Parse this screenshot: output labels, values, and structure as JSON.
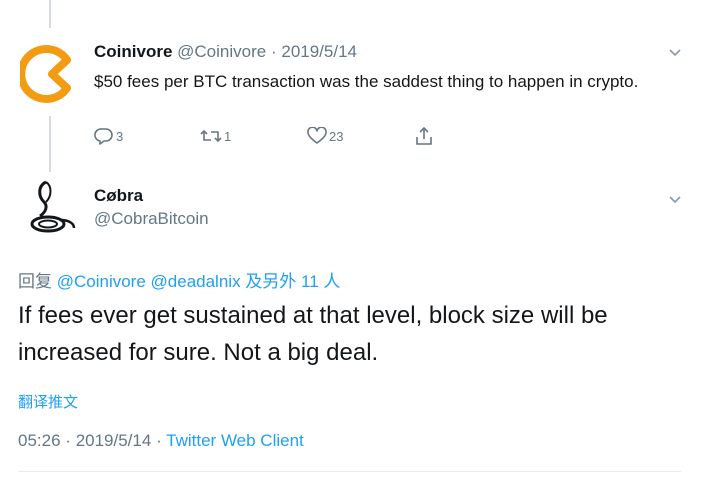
{
  "tweet1": {
    "display_name": "Coinivore",
    "handle": "@Coinivore",
    "separator": "·",
    "date": "2019/5/14",
    "text": "$50 fees per BTC transaction was the saddest thing to happen in crypto.",
    "actions": {
      "reply_count": "3",
      "retweet_count": "1",
      "like_count": "23"
    },
    "avatar_icon": "pacman-logo-icon",
    "accent_color": "#f39c12"
  },
  "tweet2": {
    "display_name": "Cøbra",
    "handle": "@CobraBitcoin",
    "reply_prefix": "回复",
    "reply_mentions": "@Coinivore @deadalnix",
    "reply_suffix": "及另外 11 人",
    "text": "If fees ever get sustained at that level, block size will be increased for sure. Not a big deal.",
    "translate_label": "翻译推文",
    "time": "05:26",
    "separator": "·",
    "date": "2019/5/14",
    "client": "Twitter Web Client",
    "avatar_icon": "cobra-logo-icon"
  },
  "colors": {
    "link": "#1da1f2",
    "muted": "#657786",
    "text": "#14171a"
  }
}
